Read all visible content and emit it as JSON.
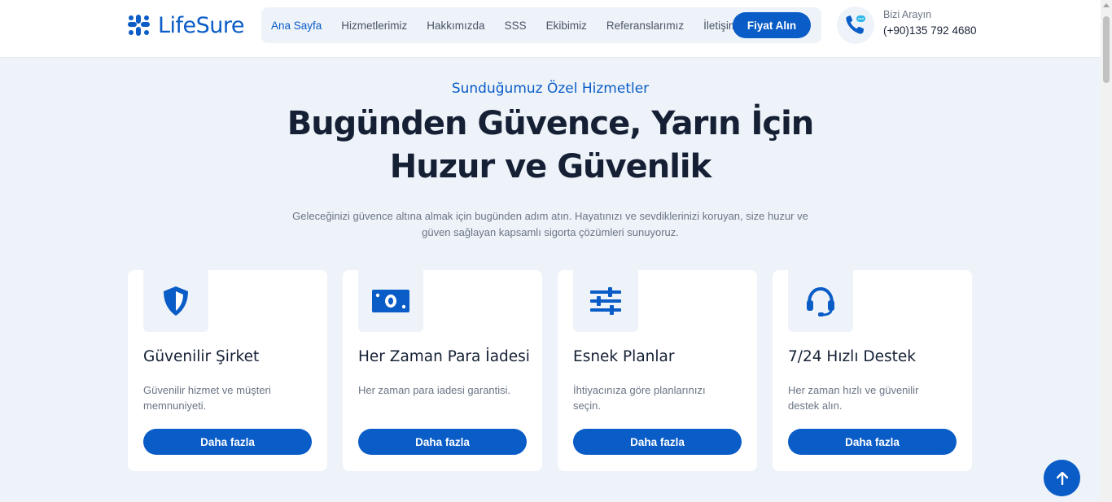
{
  "brand": {
    "name": "LifeSure",
    "color": "#0a5cc7"
  },
  "nav": {
    "items": [
      "Ana Sayfa",
      "Hizmetlerimiz",
      "Hakkımızda",
      "SSS",
      "Ekibimiz",
      "Referanslarımız",
      "İletişim"
    ],
    "active": "Ana Sayfa",
    "cta_label": "Fiyat Alın"
  },
  "contact": {
    "icon": "phone-chat-icon",
    "label": "Bizi Arayın",
    "number": "(+90)135 792 4680"
  },
  "hero": {
    "eyebrow": "Sunduğumuz Özel Hizmetler",
    "title_line1": "Bugünden Güvence, Yarın İçin",
    "title_line2": "Huzur ve Güvenlik",
    "text": "Geleceğinizi güvence altına almak için bugünden adım atın. Hayatınızı ve sevdiklerinizi koruyan, size huzur ve güven sağlayan kapsamlı sigorta çözümleri sunuyoruz."
  },
  "cards": [
    {
      "icon": "shield-icon",
      "title": "Güvenilir Şirket",
      "text": "Güvenilir hizmet ve müşteri memnuniyeti.",
      "button": "Daha fazla"
    },
    {
      "icon": "money-bill-icon",
      "title": "Her Zaman Para İadesi",
      "text": "Her zaman para iadesi garantisi.",
      "button": "Daha fazla"
    },
    {
      "icon": "sliders-icon",
      "title": "Esnek Planlar",
      "text": "İhtiyacınıza göre planlarınızı seçin.",
      "button": "Daha fazla"
    },
    {
      "icon": "headset-icon",
      "title": "7/24 Hızlı Destek",
      "text": "Her zaman hızlı ve güvenilir destek alın.",
      "button": "Daha fazla"
    }
  ],
  "back_to_top_icon": "arrow-up-icon"
}
